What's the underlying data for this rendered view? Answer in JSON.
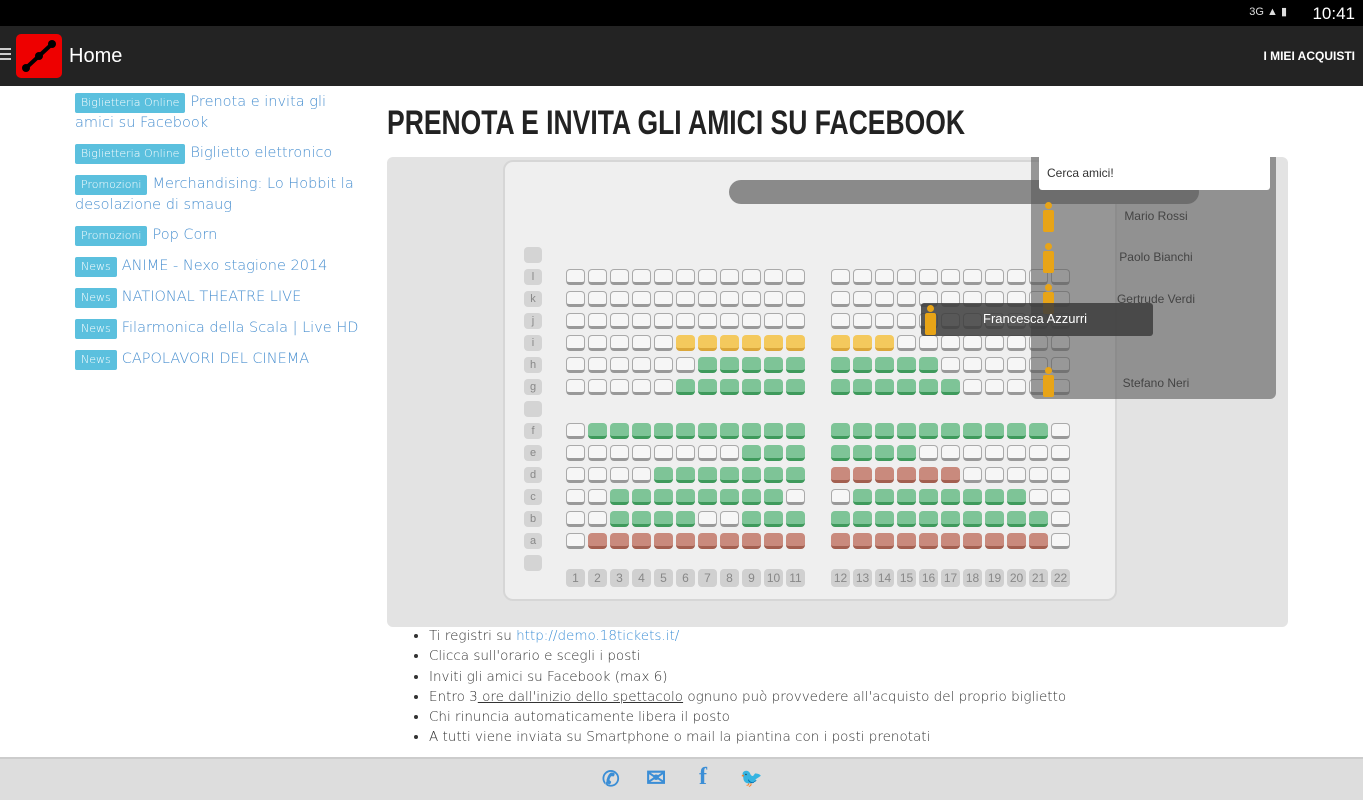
{
  "status": {
    "icons": "3G ▲ ▮",
    "time": "10:41"
  },
  "appbar": {
    "title": "Home",
    "action": "I MIEI ACQUISTI"
  },
  "sidebar": {
    "items": [
      {
        "tag": "Biglietteria Online",
        "label": "Prenota e invita gli amici su Facebook"
      },
      {
        "tag": "Biglietteria Online",
        "label": "Biglietto elettronico"
      },
      {
        "tag": "Promozioni",
        "label": "Merchandising: Lo Hobbit la desolazione di smaug"
      },
      {
        "tag": "Promozioni",
        "label": "Pop Corn"
      },
      {
        "tag": "News",
        "label": "ANIME - Nexo stagione 2014"
      },
      {
        "tag": "News",
        "label": "NATIONAL THEATRE LIVE"
      },
      {
        "tag": "News",
        "label": "Filarmonica della Scala | Live HD"
      },
      {
        "tag": "News",
        "label": "CAPOLAVORI DEL CINEMA"
      }
    ]
  },
  "article": {
    "title": "PRENOTA E INVITA GLI AMICI SU FACEBOOK",
    "seatmap": {
      "rows": [
        {
          "label": "l",
          "seats": "wwwwwwwwwwwwwwwwwwwwww"
        },
        {
          "label": "k",
          "seats": "wwwwwwwwwwwwwwwwwwwwww"
        },
        {
          "label": "j",
          "seats": "wwwwwwwwwwwwwwwwwwwwww"
        },
        {
          "label": "i",
          "seats": "wwwwwyyyyyyyyywwwwwwww"
        },
        {
          "label": "h",
          "seats": "wwwwwwggggggggggwwwwww"
        },
        {
          "label": "g",
          "seats": "wwwwwggggggggggggwwwww"
        },
        {
          "label": "f",
          "seats": "wggggggggggggggggggggw"
        },
        {
          "label": "e",
          "seats": "wwwwwwwwgggggggwwwwwww"
        },
        {
          "label": "d",
          "seats": "wwwwgggggggrrrrrrwwwww"
        },
        {
          "label": "c",
          "seats": "wwggggggggwwggggggggww"
        },
        {
          "label": "b",
          "seats": "wwggggwwgggggggggggggwww"
        },
        {
          "label": "a",
          "seats": "wrrrrrrrrrrrrrrrrrrrrw"
        }
      ],
      "numbers": [
        "1",
        "2",
        "3",
        "4",
        "5",
        "6",
        "7",
        "8",
        "9",
        "10",
        "11",
        "12",
        "13",
        "14",
        "15",
        "16",
        "17",
        "18",
        "19",
        "20",
        "21",
        "22"
      ],
      "colors": {
        "free": "#f6f6f6",
        "selected": "#f4c95d",
        "occupied": "#7ec497",
        "invited": "#c98a7d"
      },
      "friends": {
        "search": "Cerca amici!",
        "names": [
          "Mario Rossi",
          "Paolo Bianchi",
          "Gertrude Verdi",
          "Stefano Neri"
        ],
        "dragging": "Francesca Azzurri"
      }
    },
    "steps": {
      "s1_text": "Ti registri su ",
      "s1_link": "http://demo.18tickets.it/",
      "s2": "Clicca sull'orario e scegli i posti",
      "s3": "Inviti gli amici su Facebook (max 6)",
      "s4_a": "Entro 3",
      "s4_u": " ore dall'inizio dello spettacolo",
      "s4_b": " ognuno può provvedere all'acquisto del proprio biglietto",
      "s5": "Chi rinuncia automaticamente libera il posto",
      "s6": "A tutti viene inviata su Smartphone o mail la piantina con i posti prenotati"
    }
  },
  "footer": {
    "icons": [
      "phone-icon",
      "mail-icon",
      "facebook-icon",
      "twitter-icon"
    ],
    "glyphs": [
      "✆",
      "✉",
      "f",
      "🐦"
    ]
  }
}
